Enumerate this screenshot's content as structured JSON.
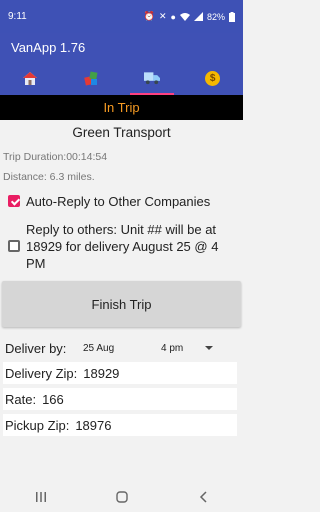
{
  "status_bar": {
    "time": "9:11",
    "battery": "82%",
    "icons": [
      "email-icon",
      "alarm-icon",
      "mute-icon",
      "location-icon",
      "wifi-icon",
      "signal-icon",
      "battery-icon"
    ]
  },
  "app": {
    "title": "VanApp 1.76"
  },
  "tabs": [
    {
      "icon": "home-icon",
      "active": false
    },
    {
      "icon": "boxes-icon",
      "active": false
    },
    {
      "icon": "truck-icon",
      "active": true
    },
    {
      "icon": "dollar-icon",
      "glyph": "$",
      "active": false
    }
  ],
  "banner": {
    "text": "In Trip"
  },
  "trip": {
    "company": "Green Transport",
    "duration": "Trip Duration:00:14:54",
    "distance": "Distance: 6.3 miles."
  },
  "auto_reply": {
    "label": "Auto-Reply to Other Companies",
    "checked": true
  },
  "reply_others": {
    "label": "Reply to others: Unit ## will be at 18929 for delivery August 25 @ 4 PM",
    "checked": false
  },
  "finish_button": {
    "label": "Finish Trip"
  },
  "deliver_by": {
    "label": "Deliver by:",
    "date": "25 Aug",
    "time": "4 pm"
  },
  "delivery_zip": {
    "label": "Delivery Zip:",
    "value": "18929"
  },
  "rate": {
    "label": "Rate:",
    "value": "166"
  },
  "pickup_zip": {
    "label": "Pickup Zip:",
    "value": "18976"
  },
  "colors": {
    "primary": "#3f51b5",
    "accent": "#ff4081",
    "banner_bg": "#000000",
    "banner_text": "#f59a23",
    "checkbox_checked": "#e91e63"
  }
}
